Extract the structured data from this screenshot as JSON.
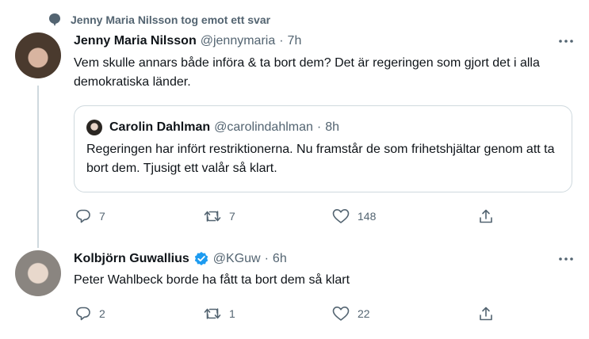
{
  "context": {
    "text": "Jenny Maria Nilsson tog emot ett svar",
    "icon": "speech-bubble-icon"
  },
  "tweets": [
    {
      "name": "Jenny Maria Nilsson",
      "handle": "@jennymaria",
      "dot": "·",
      "time": "7h",
      "text": "Vem skulle annars både införa & ta bort dem? Det är regeringen som gjort det i alla demokratiska länder.",
      "quote": {
        "name": "Carolin Dahlman",
        "handle": "@carolindahlman",
        "dot": "·",
        "time": "8h",
        "text": "Regeringen har infört restriktionerna. Nu framstår de som frihetshjältar genom att ta bort dem. Tjusigt ett valår så klart."
      },
      "actions": {
        "replies": "7",
        "retweets": "7",
        "likes": "148"
      }
    },
    {
      "name": "Kolbjörn Guwallius",
      "handle": "@KGuw",
      "dot": "·",
      "time": "6h",
      "verified": true,
      "text": "Peter Wahlbeck borde ha fått ta bort dem så klart",
      "actions": {
        "replies": "2",
        "retweets": "1",
        "likes": "22"
      }
    }
  ],
  "colors": {
    "text": "#0f1419",
    "muted": "#536471",
    "border": "#cfd9de",
    "verified": "#1d9bf0"
  }
}
